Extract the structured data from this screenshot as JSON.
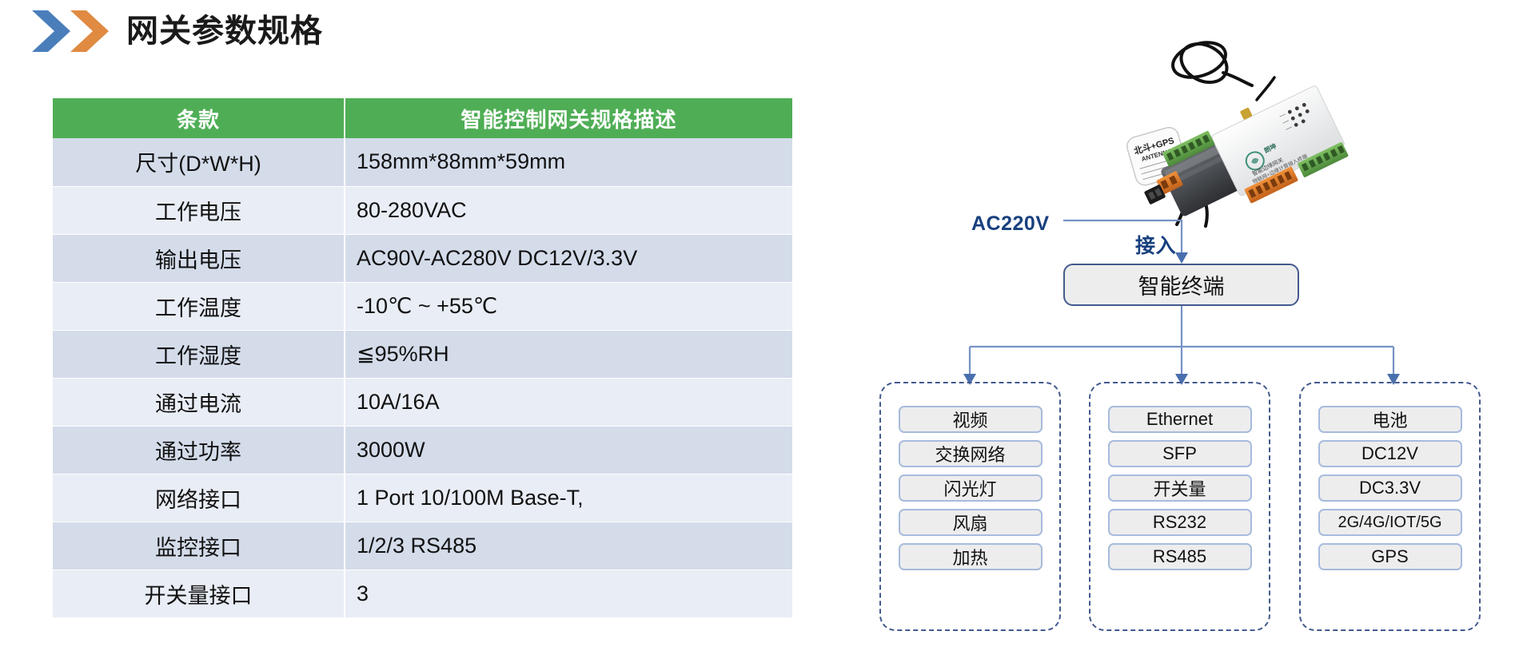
{
  "header": {
    "title": "网关参数规格",
    "chevron_blue": "#4A7EBB",
    "chevron_orange": "#E08A42"
  },
  "spec_table": {
    "columns": [
      "条款",
      "智能控制网关规格描述"
    ],
    "header_color": "#4FAE55",
    "row_colors": [
      "#D4DCEA",
      "#E9EDF5"
    ],
    "rows": [
      {
        "term": "尺寸(D*W*H)",
        "desc": "158mm*88mm*59mm"
      },
      {
        "term": "工作电压",
        "desc": "80-280VAC"
      },
      {
        "term": "输出电压",
        "desc": "AC90V-AC280V DC12V/3.3V"
      },
      {
        "term": "工作温度",
        "desc": "-10℃ ~ +55℃"
      },
      {
        "term": "工作湿度",
        "desc": "≦95%RH"
      },
      {
        "term": "通过电流",
        "desc": "10A/16A"
      },
      {
        "term": "通过功率",
        "desc": "3000W"
      },
      {
        "term": "网络接口",
        "desc": "1 Port 10/100M Base-T,"
      },
      {
        "term": "监控接口",
        "desc": "1/2/3 RS485"
      },
      {
        "term": "开关量接口",
        "desc": "3"
      }
    ]
  },
  "diagram": {
    "device_photo_label": "北斗+GPS ANTENNA",
    "power_label": "AC220V",
    "connect_label": "接入",
    "terminal_label": "智能终端",
    "line_color": "#7592C4",
    "label_color": "#18407E",
    "groups": [
      {
        "name": "group-peripherals",
        "items": [
          "视频",
          "交换网络",
          "闪光灯",
          "风扇",
          "加热"
        ]
      },
      {
        "name": "group-interfaces",
        "items": [
          "Ethernet",
          "SFP",
          "开关量",
          "RS232",
          "RS485"
        ]
      },
      {
        "name": "group-power-wireless",
        "items": [
          "电池",
          "DC12V",
          "DC3.3V",
          "2G/4G/IOT/5G",
          "GPS"
        ]
      }
    ]
  }
}
